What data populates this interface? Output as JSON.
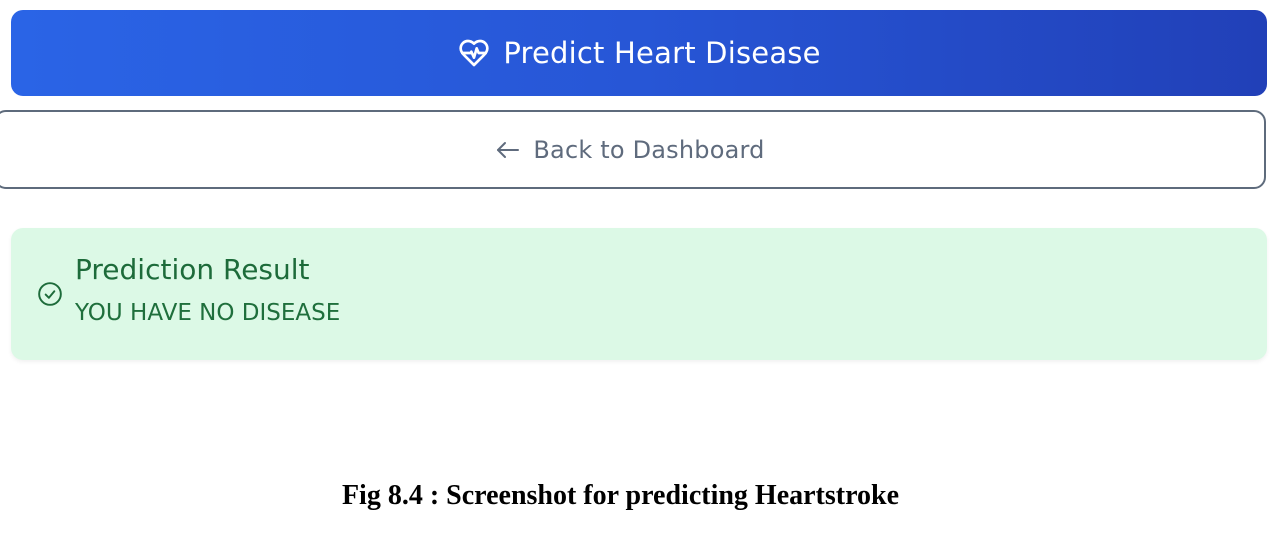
{
  "predict_button": {
    "icon": "heart-pulse-icon",
    "label": "Predict Heart Disease"
  },
  "back_button": {
    "icon": "arrow-left-icon",
    "label": "Back to Dashboard"
  },
  "result": {
    "icon": "check-circle-icon",
    "title": "Prediction Result",
    "message": "YOU HAVE NO DISEASE"
  },
  "caption": "Fig 8.4 : Screenshot for predicting Heartstroke",
  "colors": {
    "primary_gradient_start": "#2a64e6",
    "primary_gradient_end": "#2140b8",
    "success_bg": "#dcf9e6",
    "success_text": "#1d6b3a",
    "outline_border": "#5e6b7c"
  }
}
